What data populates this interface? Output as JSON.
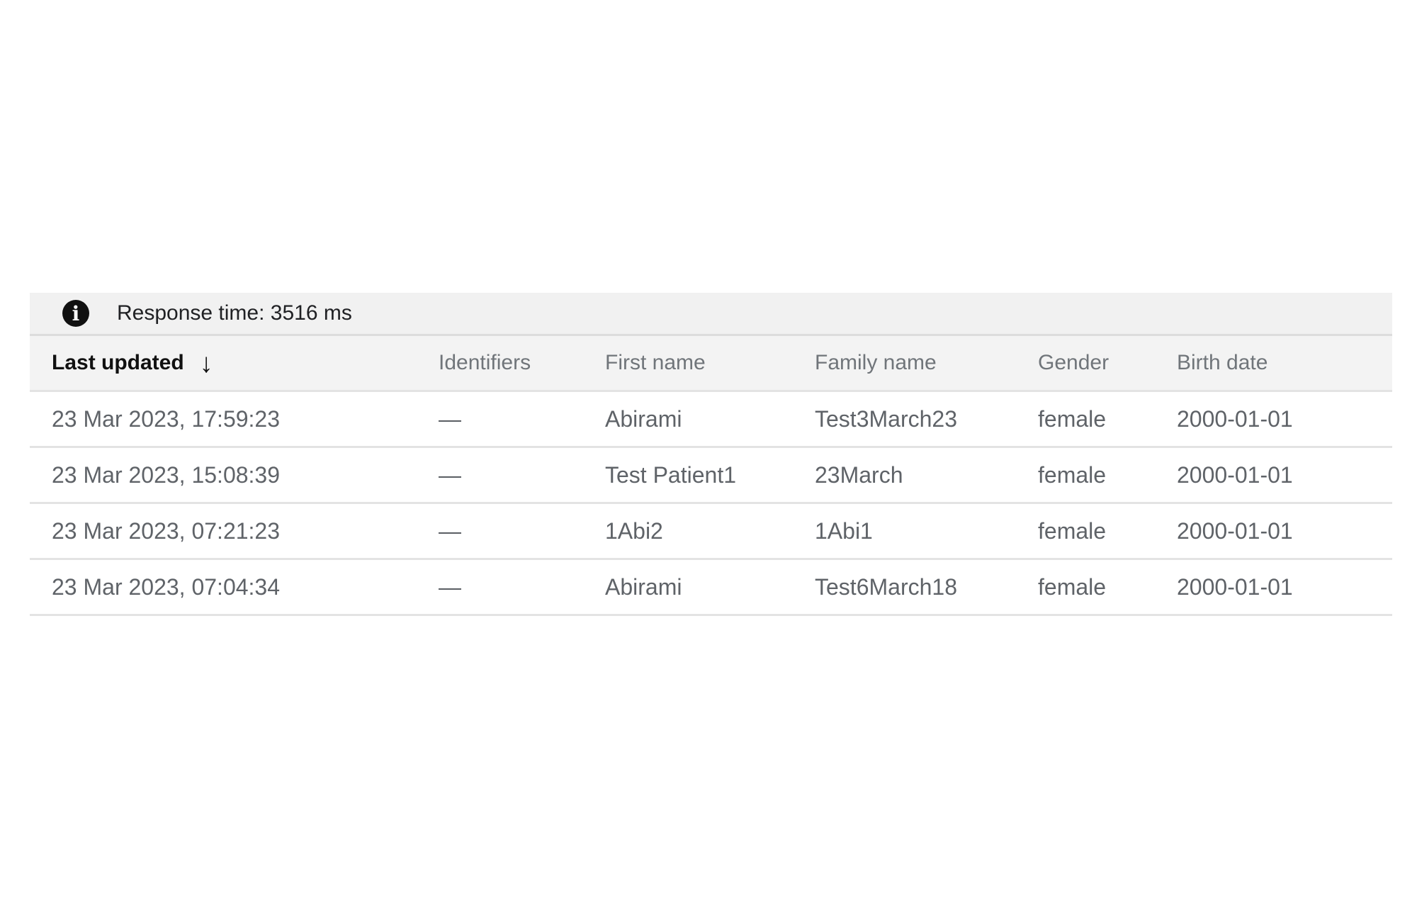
{
  "info": {
    "icon": "info-icon",
    "text": "Response time: 3516 ms"
  },
  "table": {
    "columns": [
      "Last updated",
      "Identifiers",
      "First name",
      "Family name",
      "Gender",
      "Birth date"
    ],
    "sort": {
      "column": "Last updated",
      "direction": "descending",
      "icon": "arrow-down-icon"
    },
    "rows": [
      [
        "23 Mar 2023, 17:59:23",
        "—",
        "Abirami",
        "Test3March23",
        "female",
        "2000-01-01"
      ],
      [
        "23 Mar 2023, 15:08:39",
        "—",
        "Test Patient1",
        "23March",
        "female",
        "2000-01-01"
      ],
      [
        "23 Mar 2023, 07:21:23",
        "—",
        "1Abi2",
        "1Abi1",
        "female",
        "2000-01-01"
      ],
      [
        "23 Mar 2023, 07:04:34",
        "—",
        "Abirami",
        "Test6March18",
        "female",
        "2000-01-01"
      ]
    ]
  }
}
